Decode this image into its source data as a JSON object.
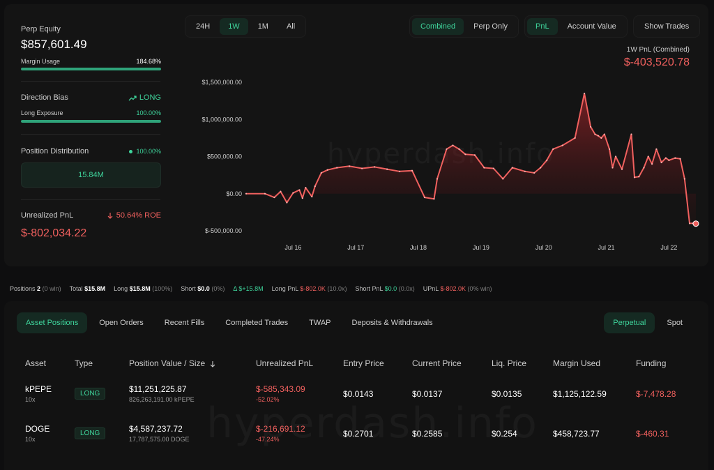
{
  "summary": {
    "perp_equity_label": "Perp Equity",
    "perp_equity_value": "$857,601.49",
    "margin_usage_label": "Margin Usage",
    "margin_usage_value": "184.68%",
    "margin_usage_fill": 1.0,
    "direction_bias_label": "Direction Bias",
    "direction_bias_value": "LONG",
    "long_exposure_label": "Long Exposure",
    "long_exposure_value": "100.00%",
    "long_exposure_fill": 1.0,
    "position_distribution_label": "Position Distribution",
    "position_distribution_value": "100.00%",
    "distribution_box_value": "15.84M",
    "unrealized_pnl_label": "Unrealized PnL",
    "roe_value": "50.64% ROE",
    "unrealized_pnl_value": "$-802,034.22"
  },
  "time_tabs": [
    {
      "label": "24H",
      "active": false
    },
    {
      "label": "1W",
      "active": true
    },
    {
      "label": "1M",
      "active": false
    },
    {
      "label": "All",
      "active": false
    }
  ],
  "mode_tabs": [
    {
      "label": "Combined",
      "active": true
    },
    {
      "label": "Perp Only",
      "active": false
    }
  ],
  "metric_tabs": [
    {
      "label": "PnL",
      "active": true
    },
    {
      "label": "Account Value",
      "active": false
    }
  ],
  "show_trades_label": "Show Trades",
  "pnl_title": "1W PnL (Combined)",
  "pnl_value": "$-403,520.78",
  "watermark": "hyperdash.info",
  "colors": {
    "accent_green": "#3fd59c",
    "loss_red": "#f0605e",
    "background": "#0e0e0f"
  },
  "chart_data": {
    "type": "area",
    "y_ticks": [
      "$1,500,000.00",
      "$1,000,000.00",
      "$500,000.00",
      "$0.00",
      "$-500,000.00"
    ],
    "y_tick_values": [
      1500000,
      1000000,
      500000,
      0,
      -500000
    ],
    "x_ticks": [
      "Jul 16",
      "Jul 17",
      "Jul 18",
      "Jul 19",
      "Jul 20",
      "Jul 21",
      "Jul 22"
    ],
    "x_tick_values": [
      16,
      17,
      18,
      19,
      20,
      21,
      22
    ],
    "ylim": [
      -500000,
      1500000
    ],
    "xlim": [
      15.25,
      22.43
    ],
    "grid": false,
    "x": [
      15.25,
      15.55,
      15.7,
      15.8,
      15.9,
      16.0,
      16.1,
      16.15,
      16.2,
      16.3,
      16.35,
      16.45,
      16.55,
      16.7,
      16.9,
      17.1,
      17.3,
      17.5,
      17.7,
      17.9,
      18.1,
      18.25,
      18.3,
      18.45,
      18.55,
      18.65,
      18.75,
      18.9,
      19.05,
      19.2,
      19.35,
      19.5,
      19.7,
      19.85,
      19.95,
      20.05,
      20.15,
      20.3,
      20.5,
      20.65,
      20.75,
      20.82,
      20.87,
      20.92,
      20.97,
      21.05,
      21.1,
      21.15,
      21.25,
      21.4,
      21.45,
      21.52,
      21.6,
      21.67,
      21.73,
      21.8,
      21.88,
      21.95,
      22.0,
      22.1,
      22.18,
      22.25,
      22.33,
      22.38,
      22.4,
      22.43
    ],
    "y": [
      0,
      0,
      -50000,
      30000,
      -120000,
      10000,
      50000,
      -60000,
      80000,
      -40000,
      100000,
      280000,
      320000,
      350000,
      370000,
      340000,
      360000,
      330000,
      300000,
      310000,
      -50000,
      -70000,
      200000,
      600000,
      650000,
      600000,
      530000,
      520000,
      350000,
      340000,
      200000,
      350000,
      300000,
      280000,
      350000,
      450000,
      600000,
      650000,
      750000,
      1350000,
      900000,
      800000,
      780000,
      750000,
      800000,
      600000,
      350000,
      500000,
      330000,
      800000,
      220000,
      230000,
      350000,
      500000,
      400000,
      600000,
      420000,
      480000,
      450000,
      480000,
      470000,
      200000,
      -400000,
      -400000,
      -403520,
      -403520
    ]
  },
  "positions_strip": {
    "positions_label": "Positions",
    "positions_count": "2",
    "positions_win": "(0 win)",
    "total_label": "Total",
    "total_value": "$15.8M",
    "long_label": "Long",
    "long_value": "$15.8M",
    "long_pct": "(100%)",
    "short_label": "Short",
    "short_value": "$0.0",
    "short_pct": "(0%)",
    "delta_label": "Δ",
    "delta_value": "$+15.8M",
    "long_pnl_label": "Long PnL",
    "long_pnl_value": "$-802.0K",
    "long_pnl_lev": "(10.0x)",
    "short_pnl_label": "Short PnL",
    "short_pnl_value": "$0.0",
    "short_pnl_lev": "(0.0x)",
    "upnl_label": "UPnL",
    "upnl_value": "$-802.0K",
    "upnl_win": "(0% win)"
  },
  "bottom_tabs": [
    {
      "label": "Asset Positions",
      "active": true
    },
    {
      "label": "Open Orders",
      "active": false
    },
    {
      "label": "Recent Fills",
      "active": false
    },
    {
      "label": "Completed Trades",
      "active": false
    },
    {
      "label": "TWAP",
      "active": false
    },
    {
      "label": "Deposits & Withdrawals",
      "active": false
    }
  ],
  "market_toggle": [
    {
      "label": "Perpetual",
      "active": true
    },
    {
      "label": "Spot",
      "active": false
    }
  ],
  "table": {
    "headers": {
      "asset": "Asset",
      "type": "Type",
      "position_value": "Position Value / Size",
      "unrealized_pnl": "Unrealized PnL",
      "entry_price": "Entry Price",
      "current_price": "Current Price",
      "liq_price": "Liq. Price",
      "margin_used": "Margin Used",
      "funding": "Funding"
    },
    "rows": [
      {
        "asset": "kPEPE",
        "leverage": "10x",
        "type": "LONG",
        "position_value": "$11,251,225.87",
        "size": "826,263,191.00 kPEPE",
        "upnl": "$-585,343.09",
        "upnl_pct": "-52.02%",
        "entry": "$0.0143",
        "current": "$0.0137",
        "liq": "$0.0135",
        "margin": "$1,125,122.59",
        "funding": "$-7,478.28"
      },
      {
        "asset": "DOGE",
        "leverage": "10x",
        "type": "LONG",
        "position_value": "$4,587,237.72",
        "size": "17,787,575.00 DOGE",
        "upnl": "$-216,691.12",
        "upnl_pct": "-47.24%",
        "entry": "$0.2701",
        "current": "$0.2585",
        "liq": "$0.254",
        "margin": "$458,723.77",
        "funding": "$-460.31"
      }
    ]
  }
}
